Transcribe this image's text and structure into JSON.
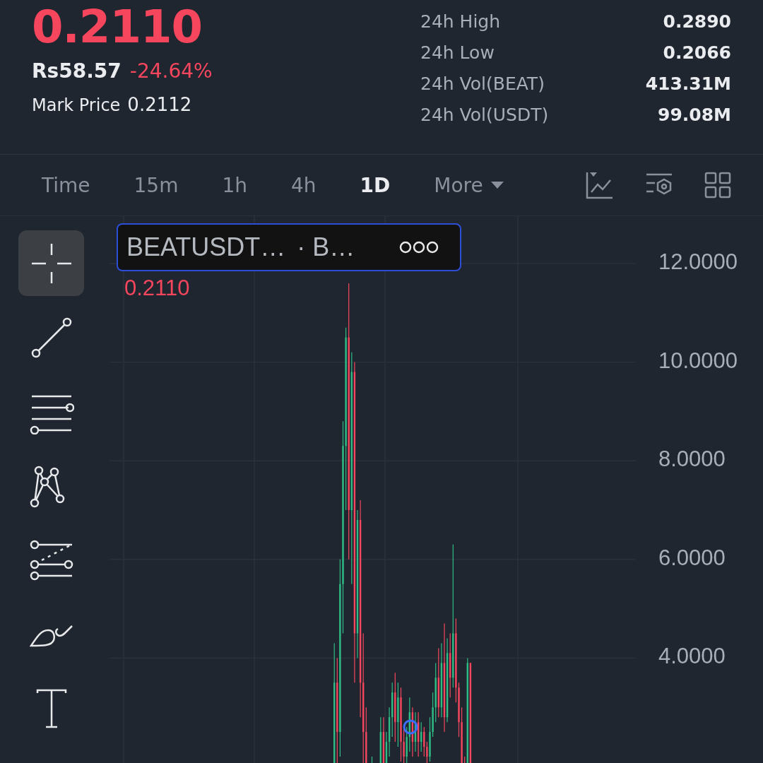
{
  "ticker": {
    "last_price": "0.2110",
    "local_price": "Rs58.57",
    "change": "-24.64%",
    "mark_price_label": "Mark Price",
    "mark_price": "0.2112"
  },
  "stats": [
    {
      "label": "24h High",
      "value": "0.2890"
    },
    {
      "label": "24h Low",
      "value": "0.2066"
    },
    {
      "label": "24h Vol(BEAT)",
      "value": "413.31M"
    },
    {
      "label": "24h Vol(USDT)",
      "value": "99.08M"
    }
  ],
  "timeframes": [
    {
      "label": "Time",
      "selected": false
    },
    {
      "label": "15m",
      "selected": false
    },
    {
      "label": "1h",
      "selected": false
    },
    {
      "label": "4h",
      "selected": false
    },
    {
      "label": "1D",
      "selected": true
    }
  ],
  "more_menu": {
    "label": "More"
  },
  "drawing_tools": [
    {
      "kind": "crosshair",
      "selected": true
    },
    {
      "kind": "trend-line",
      "selected": false
    },
    {
      "kind": "channel",
      "selected": false
    },
    {
      "kind": "pattern",
      "selected": false
    },
    {
      "kind": "fib",
      "selected": false
    },
    {
      "kind": "brush",
      "selected": false
    },
    {
      "kind": "text",
      "selected": false
    }
  ],
  "chart": {
    "legend": {
      "symbol": "BEATUSDT…",
      "interval": "· B…"
    },
    "last_price_label": "0.2110",
    "y_axis_labels": [
      "12.0000",
      "10.0000",
      "8.0000",
      "6.0000",
      "4.0000"
    ]
  }
}
